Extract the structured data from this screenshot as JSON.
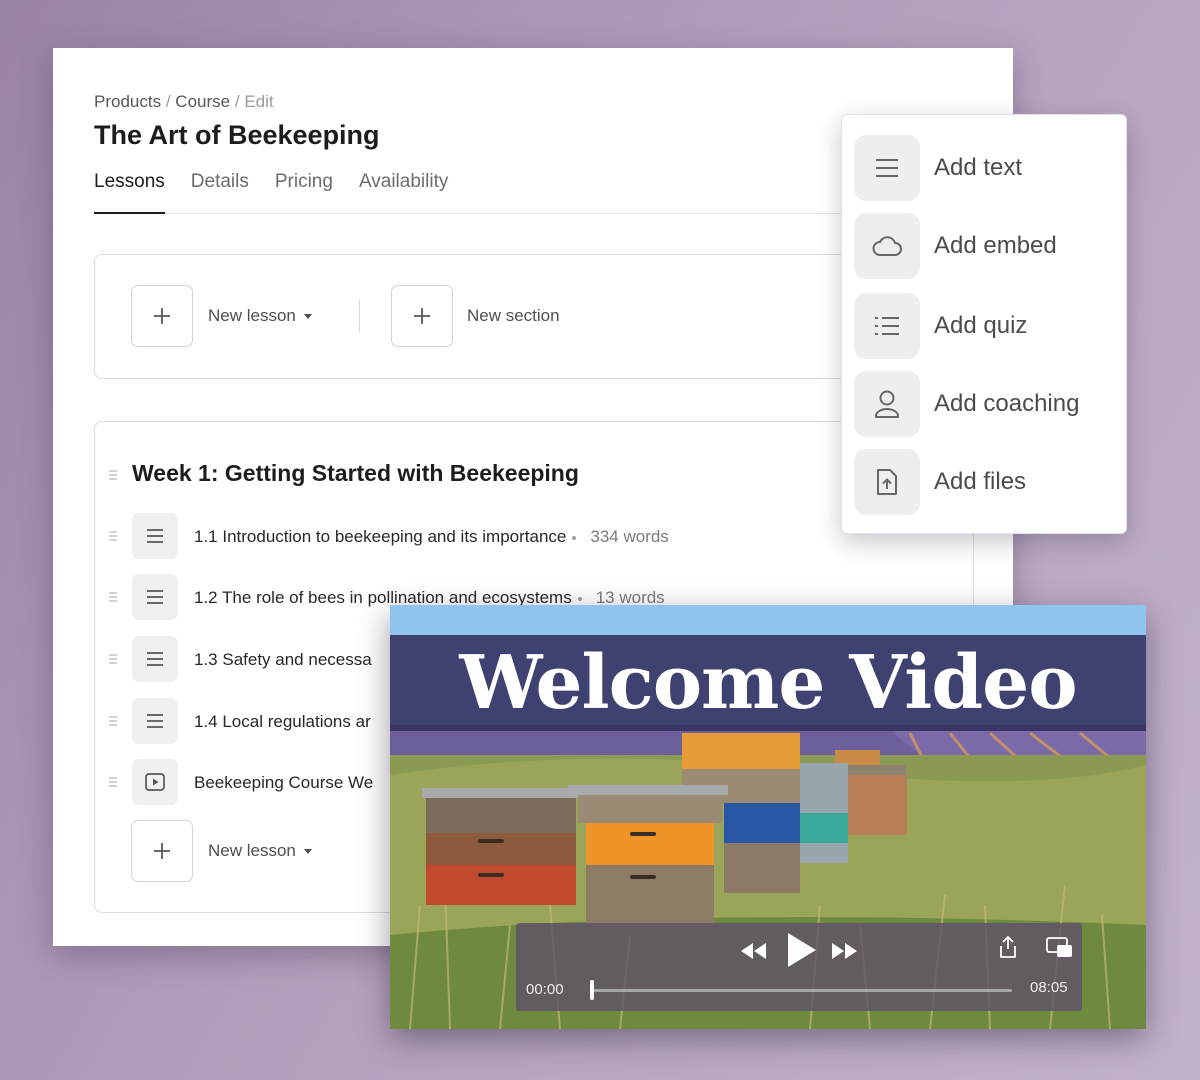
{
  "breadcrumb": {
    "products": "Products",
    "sep1": "/",
    "course": "Course",
    "sep2": "/",
    "edit": "Edit"
  },
  "page_title": "The Art of Beekeeping",
  "tabs": [
    {
      "label": "Lessons",
      "active": true
    },
    {
      "label": "Details",
      "active": false
    },
    {
      "label": "Pricing",
      "active": false
    },
    {
      "label": "Availability",
      "active": false
    }
  ],
  "toolbar": {
    "new_lesson": "New lesson",
    "new_section": "New section"
  },
  "section": {
    "title": "Week 1: Getting Started with Beekeeping",
    "lessons": [
      {
        "title": "1.1 Introduction to beekeeping and its importance",
        "meta": "334 words",
        "icon": "text-lines-icon"
      },
      {
        "title": "1.2 The role of bees in pollination and ecosystems",
        "meta": "13 words",
        "icon": "text-lines-icon"
      },
      {
        "title": "1.3 Safety and necessa",
        "meta": "",
        "icon": "text-lines-icon"
      },
      {
        "title": "1.4 Local regulations ar",
        "meta": "",
        "icon": "text-lines-icon"
      },
      {
        "title": "Beekeeping Course We",
        "meta": "",
        "icon": "play-icon"
      }
    ],
    "new_lesson": "New lesson"
  },
  "menu": {
    "items": [
      {
        "label": "Add text",
        "icon": "text-lines-icon"
      },
      {
        "label": "Add embed",
        "icon": "cloud-icon"
      },
      {
        "label": "Add quiz",
        "icon": "list-icon"
      },
      {
        "label": "Add coaching",
        "icon": "person-icon"
      },
      {
        "label": "Add files",
        "icon": "file-upload-icon"
      }
    ]
  },
  "video": {
    "title": "Welcome Video",
    "current_time": "00:00",
    "duration": "08:05",
    "progress": 0
  },
  "colors": {
    "background": "#b29fbd",
    "video_title_band": "#34305f",
    "controls_bg": "#5f4e6c"
  }
}
